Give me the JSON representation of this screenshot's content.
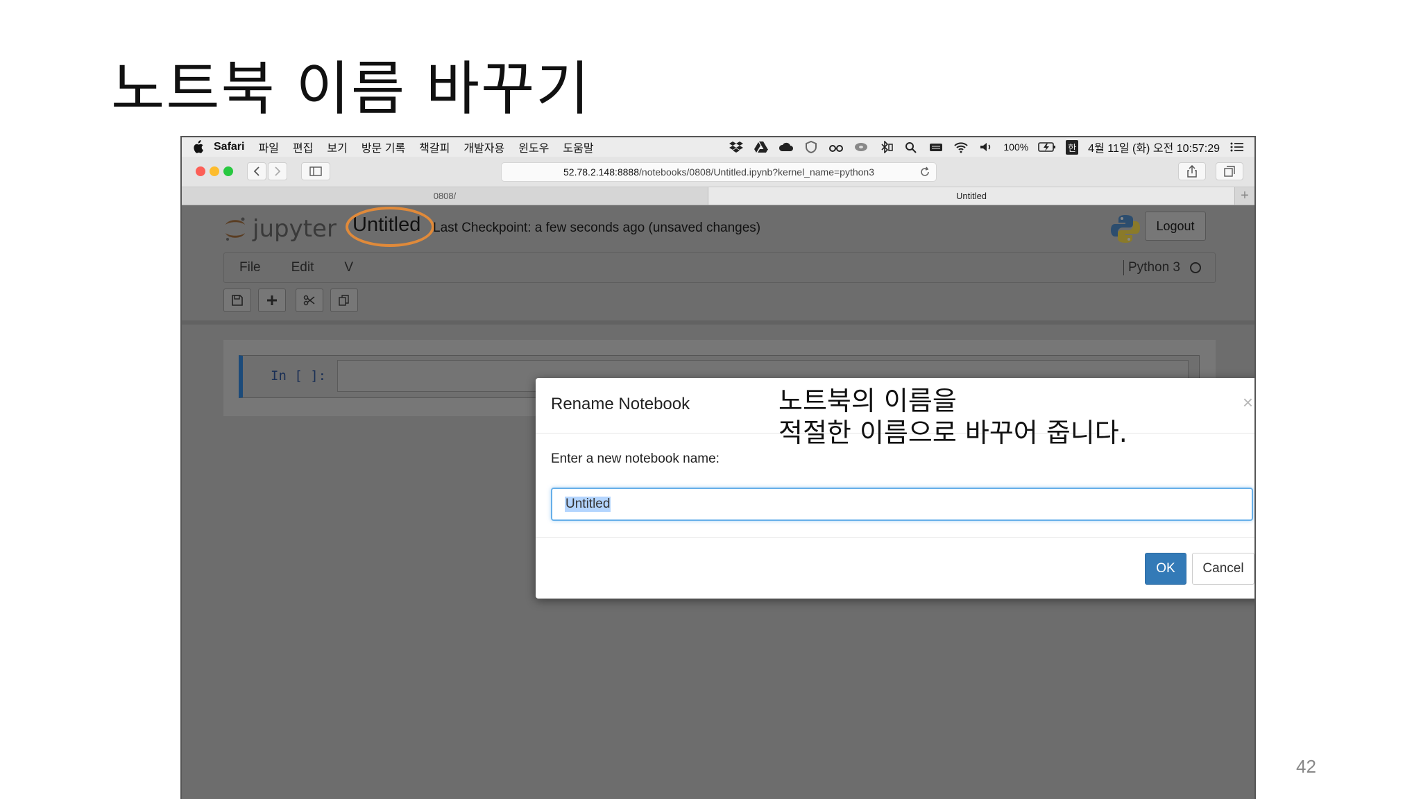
{
  "slide": {
    "title": "노트북 이름 바꾸기",
    "page_number": "42"
  },
  "menubar": {
    "app_name": "Safari",
    "items": [
      "파일",
      "편집",
      "보기",
      "방문 기록",
      "책갈피",
      "개발자용",
      "윈도우",
      "도움말"
    ],
    "battery": "100%",
    "input_method": "한",
    "datetime": "4월 11일 (화) 오전 10:57:29"
  },
  "browser": {
    "url_host": "52.78.2.148:8888",
    "url_path": "/notebooks/0808/Untitled.ipynb?kernel_name=python3",
    "tabs": [
      {
        "label": "0808/"
      },
      {
        "label": "Untitled"
      }
    ]
  },
  "jupyter": {
    "logo_text": "jupyter",
    "notebook_name": "Untitled",
    "checkpoint": "Last Checkpoint: a few seconds ago (unsaved changes)",
    "logout_label": "Logout",
    "menu": [
      "File",
      "Edit",
      "V"
    ],
    "kernel_name": "Python 3",
    "cell_prompt": "In [ ]:",
    "colors": {
      "highlight": "#e08a3a",
      "cell_border": "#1c4b7a"
    }
  },
  "modal": {
    "title": "Rename Notebook",
    "close_symbol": "×",
    "label": "Enter a new notebook name:",
    "input_value": "Untitled",
    "ok_label": "OK",
    "cancel_label": "Cancel",
    "annotation_line1": "노트북의 이름을",
    "annotation_line2": "적절한 이름으로 바꾸어 줍니다.",
    "colors": {
      "primary": "#337ab7",
      "focus": "#66afe9"
    }
  }
}
